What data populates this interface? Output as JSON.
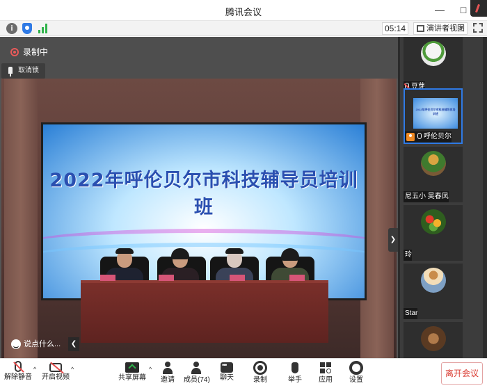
{
  "window": {
    "title": "腾讯会议"
  },
  "infobar": {
    "timer": "05:14",
    "view_mode": "演讲者视图"
  },
  "stage": {
    "recording_label": "录制中",
    "unpin_label": "取消锁定",
    "banner_text": "2022年呼伦贝尔市科技辅导员培训班",
    "chat_placeholder": "说点什么..."
  },
  "participants": [
    {
      "name": "豆芽",
      "muted": true,
      "presenter": false
    },
    {
      "name": "呼伦贝尔",
      "muted": false,
      "presenter": true,
      "thumb_text": "2022年呼伦贝尔市科技辅导员培训班"
    },
    {
      "name": "尼五小 吴春凤",
      "muted": false,
      "presenter": false
    },
    {
      "name": "玲",
      "muted": false,
      "presenter": false
    },
    {
      "name": "Star",
      "muted": false,
      "presenter": false
    }
  ],
  "toolbar": {
    "unmute": "解除静音",
    "start_video": "开启视频",
    "share_screen": "共享屏幕",
    "invite": "邀请",
    "members": "成员(74)",
    "chat": "聊天",
    "record": "录制",
    "raise_hand": "举手",
    "apps": "应用",
    "settings": "设置",
    "leave": "离开会议"
  },
  "colors": {
    "accent": "#2f7ae5",
    "danger": "#d9382e",
    "signal": "#2fb34a"
  }
}
